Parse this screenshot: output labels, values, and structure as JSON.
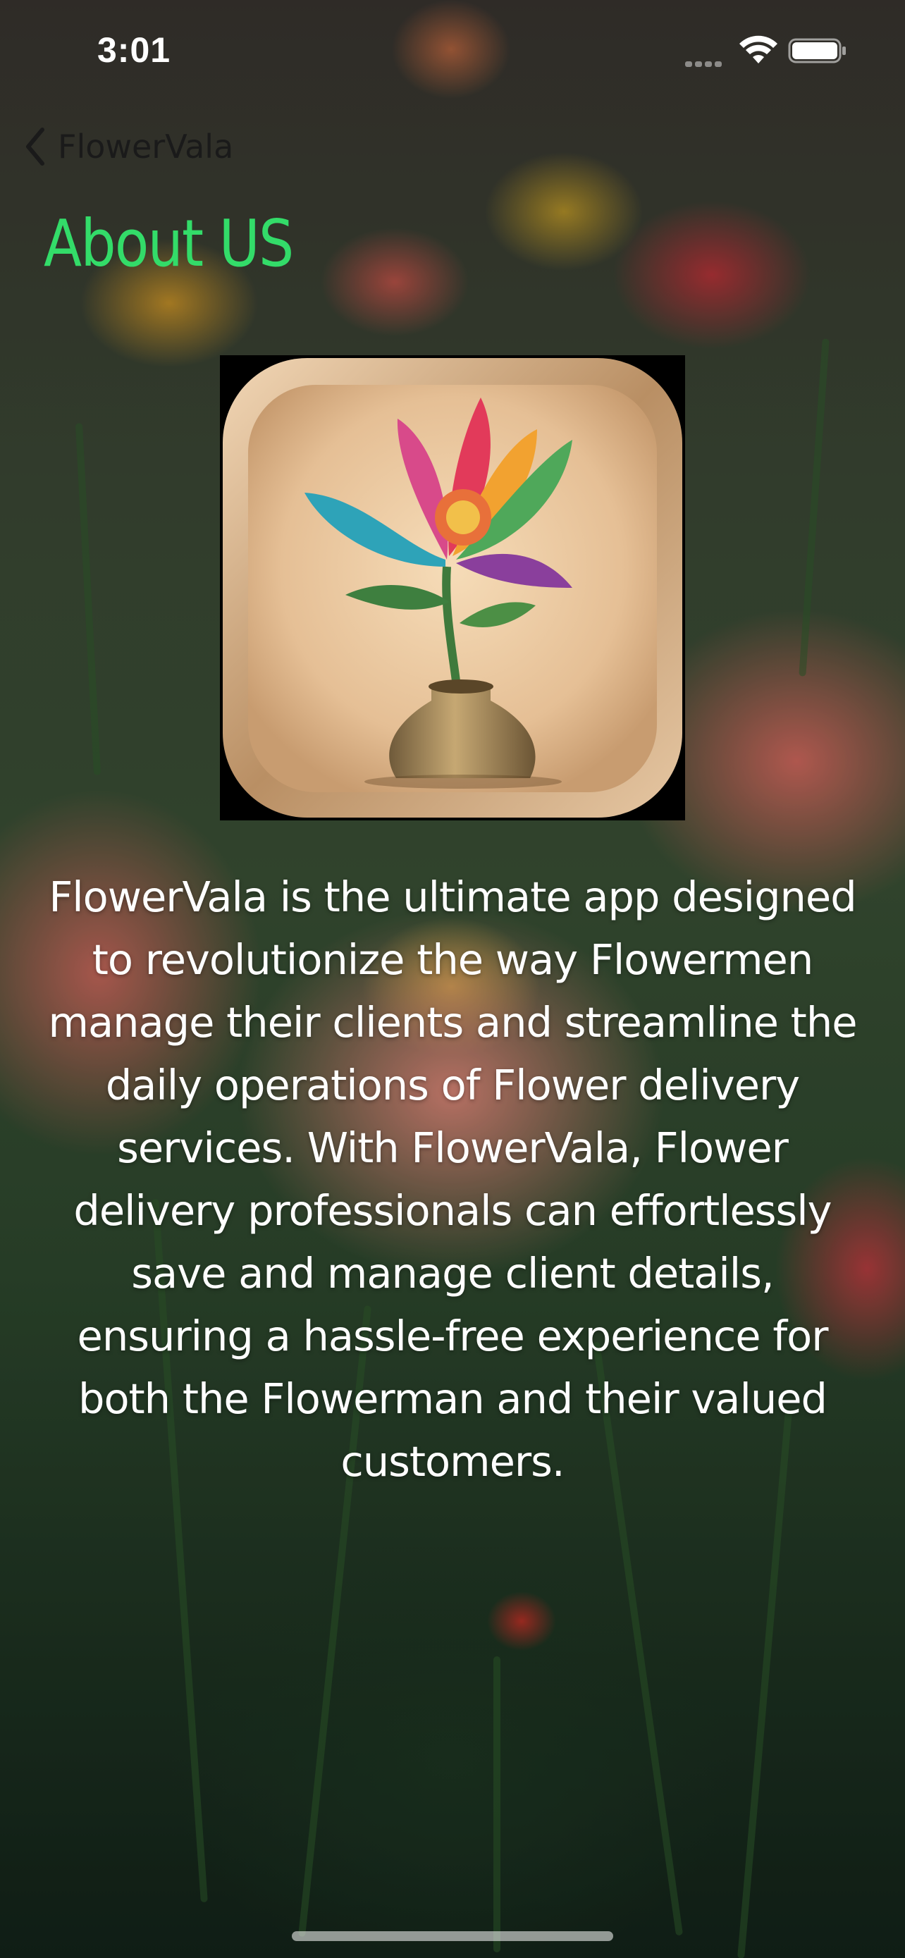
{
  "status_bar": {
    "time": "3:01",
    "icons": [
      "cellular-signal-icon",
      "wifi-icon",
      "battery-icon"
    ]
  },
  "nav": {
    "back_icon": "chevron-left-icon",
    "back_label": "FlowerVala"
  },
  "page": {
    "title": "About US",
    "logo_icon": "flower-vase-logo",
    "description": "FlowerVala is the ultimate app designed to revolutionize the way Flowermen manage their clients and streamline the daily operations of Flower delivery services. With FlowerVala, Flower delivery professionals can effortlessly save and manage client details, ensuring a hassle-free experience for both the Flowerman and their valued customers."
  },
  "colors": {
    "title": "#33dc69",
    "body_text": "#ffffff",
    "back_label": "#1a1a1a"
  }
}
